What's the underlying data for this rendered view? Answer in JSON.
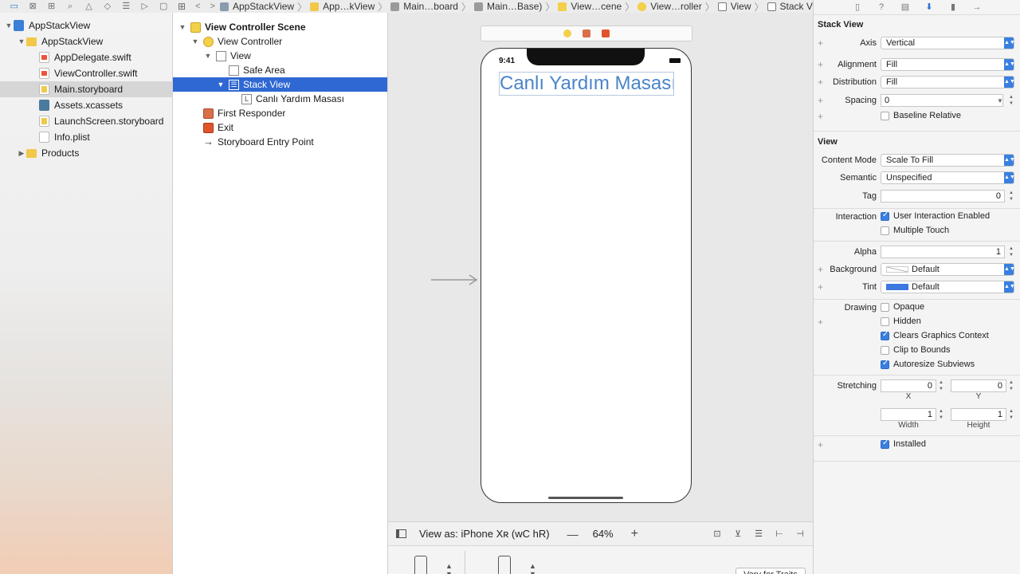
{
  "breadcrumbs": [
    "AppStackView",
    "App…kView",
    "Main…board",
    "Main…Base)",
    "View…cene",
    "View…roller",
    "View",
    "Stack View"
  ],
  "navigator": {
    "items": [
      {
        "label": "AppStackView",
        "kind": "proj",
        "indent": 0,
        "disclosure": "▼"
      },
      {
        "label": "AppStackView",
        "kind": "folder",
        "indent": 1,
        "disclosure": "▼"
      },
      {
        "label": "AppDelegate.swift",
        "kind": "swift",
        "indent": 2,
        "disclosure": ""
      },
      {
        "label": "ViewController.swift",
        "kind": "swift",
        "indent": 2,
        "disclosure": ""
      },
      {
        "label": "Main.storyboard",
        "kind": "sb",
        "indent": 2,
        "disclosure": "",
        "selected": true
      },
      {
        "label": "Assets.xcassets",
        "kind": "assets",
        "indent": 2,
        "disclosure": ""
      },
      {
        "label": "LaunchScreen.storyboard",
        "kind": "sb",
        "indent": 2,
        "disclosure": ""
      },
      {
        "label": "Info.plist",
        "kind": "plist",
        "indent": 2,
        "disclosure": ""
      },
      {
        "label": "Products",
        "kind": "folder",
        "indent": 1,
        "disclosure": "▶"
      }
    ]
  },
  "outline": {
    "items": [
      {
        "label": "View Controller Scene",
        "icon": "scene",
        "indent": 0,
        "disclosure": "▼",
        "bold": true
      },
      {
        "label": "View Controller",
        "icon": "vc",
        "indent": 1,
        "disclosure": "▼"
      },
      {
        "label": "View",
        "icon": "view",
        "indent": 2,
        "disclosure": "▼"
      },
      {
        "label": "Safe Area",
        "icon": "view",
        "indent": 3,
        "disclosure": ""
      },
      {
        "label": "Stack View",
        "icon": "stack",
        "indent": 3,
        "disclosure": "▼",
        "selected": true
      },
      {
        "label": "Canlı Yardım Masası",
        "icon": "label",
        "indent": 4,
        "disclosure": ""
      },
      {
        "label": "First Responder",
        "icon": "fr",
        "indent": 1,
        "disclosure": ""
      },
      {
        "label": "Exit",
        "icon": "exit",
        "indent": 1,
        "disclosure": ""
      },
      {
        "label": "Storyboard Entry Point",
        "icon": "entry",
        "indent": 1,
        "disclosure": ""
      }
    ]
  },
  "canvas": {
    "status_time": "9:41",
    "label_text": "Canlı Yardım Masası"
  },
  "bottombar": {
    "view_as": "View as: iPhone Xʀ (wC hR)",
    "zoom_minus": "—",
    "zoom": "64%",
    "zoom_plus": "+"
  },
  "devicebar": {
    "vary_button": "Vary for Traits"
  },
  "inspector": {
    "stack_section": "Stack View",
    "axis_label": "Axis",
    "axis_value": "Vertical",
    "alignment_label": "Alignment",
    "alignment_value": "Fill",
    "distribution_label": "Distribution",
    "distribution_value": "Fill",
    "spacing_label": "Spacing",
    "spacing_value": "0",
    "baseline_label": "Baseline Relative",
    "view_section": "View",
    "content_mode_label": "Content Mode",
    "content_mode_value": "Scale To Fill",
    "semantic_label": "Semantic",
    "semantic_value": "Unspecified",
    "tag_label": "Tag",
    "tag_value": "0",
    "interaction_label": "Interaction",
    "user_interaction_label": "User Interaction Enabled",
    "multiple_touch_label": "Multiple Touch",
    "alpha_label": "Alpha",
    "alpha_value": "1",
    "background_label": "Background",
    "background_value": "Default",
    "tint_label": "Tint",
    "tint_value": "Default",
    "tint_color": "#3c78e0",
    "drawing_label": "Drawing",
    "opaque_label": "Opaque",
    "hidden_label": "Hidden",
    "clears_label": "Clears Graphics Context",
    "clip_label": "Clip to Bounds",
    "autoresize_label": "Autoresize Subviews",
    "stretching_label": "Stretching",
    "stretch_x": "0",
    "stretch_y": "0",
    "stretch_w": "1",
    "stretch_h": "1",
    "x_label": "X",
    "y_label": "Y",
    "width_label": "Width",
    "height_label": "Height",
    "installed_label": "Installed"
  }
}
